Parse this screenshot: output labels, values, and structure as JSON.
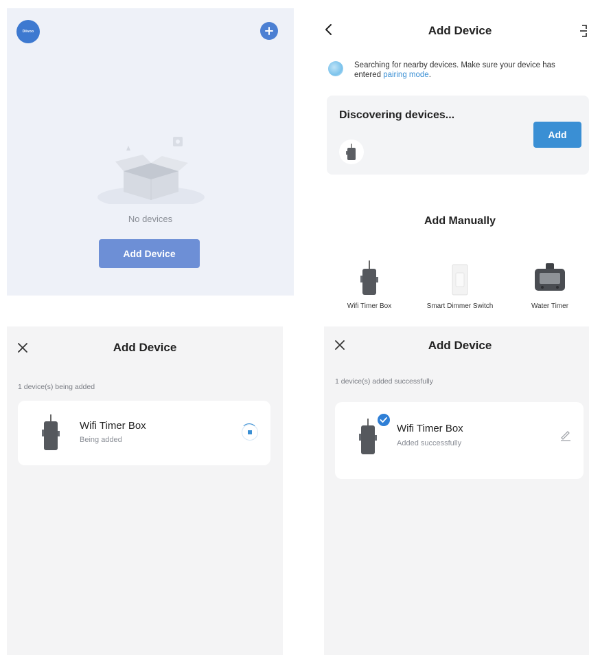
{
  "home": {
    "logo_text": "Diivoo",
    "empty_text": "No devices",
    "add_button": "Add Device"
  },
  "discover": {
    "title": "Add Device",
    "hint_text": "Searching for nearby devices. Make sure your device has entered ",
    "hint_link": "pairing mode",
    "hint_end": ".",
    "discovering_title": "Discovering devices...",
    "add_button": "Add",
    "manual_title": "Add Manually",
    "categories": [
      {
        "label": "Wifi Timer Box",
        "icon": "wifi-timer-box-icon"
      },
      {
        "label": "Smart Dimmer Switch",
        "icon": "smart-dimmer-switch-icon"
      },
      {
        "label": "Water Timer",
        "icon": "water-timer-icon"
      }
    ]
  },
  "adding": {
    "title": "Add Device",
    "subtitle": "1 device(s) being added",
    "device_name": "Wifi Timer Box",
    "device_status": "Being added"
  },
  "added": {
    "title": "Add Device",
    "subtitle": "1 device(s) added successfully",
    "device_name": "Wifi Timer Box",
    "device_status": "Added successfully"
  },
  "colors": {
    "accent": "#3a8fd4",
    "home_button": "#6d8fd6",
    "home_bg": "#eef1f8",
    "panel_bg": "#f4f4f5"
  }
}
